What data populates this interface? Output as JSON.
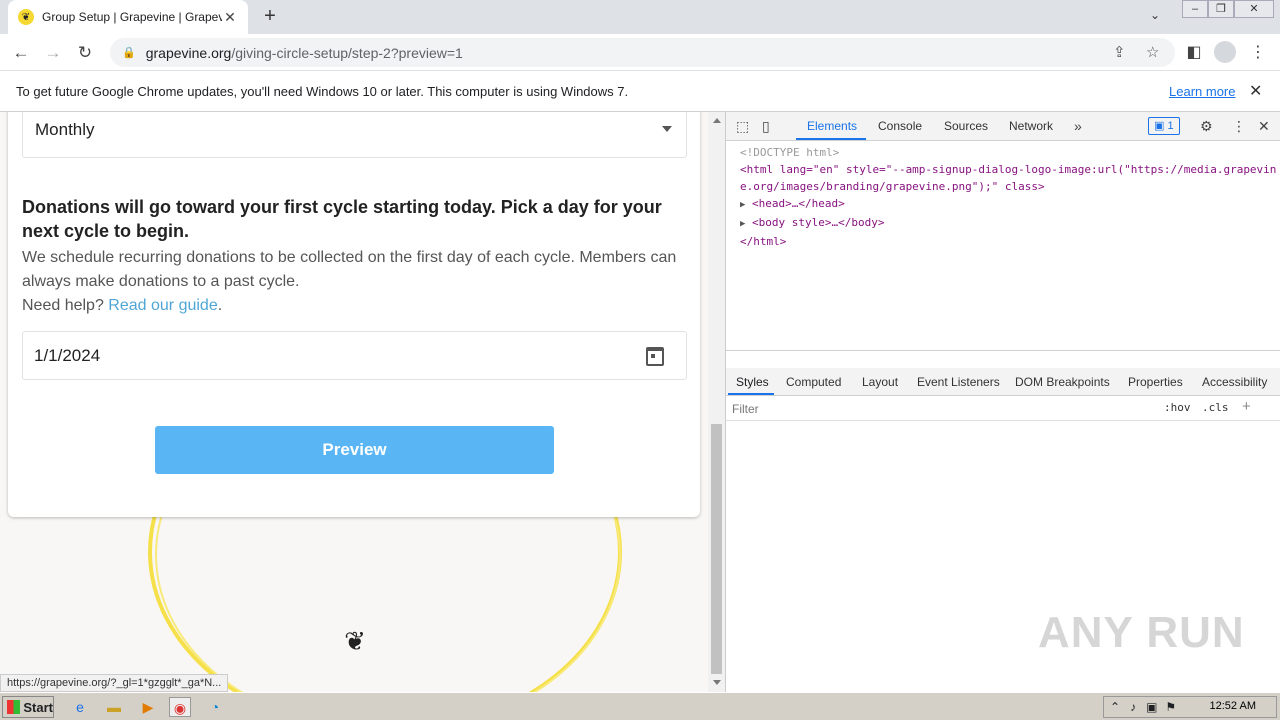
{
  "browser": {
    "tab_title": "Group Setup | Grapevine | Grapevine",
    "tab_close": "✕",
    "new_tab": "+",
    "url_host": "grapevine.org",
    "url_path": "/giving-circle-setup/step-2?preview=1"
  },
  "infobar": {
    "message": "To get future Google Chrome updates, you'll need Windows 10 or later. This computer is using Windows 7.",
    "link": "Learn more"
  },
  "form": {
    "frequency_value": "Monthly",
    "heading": "Donations will go toward your first cycle starting today. Pick a day for your next cycle to begin.",
    "description": "We schedule recurring donations to be collected on the first day of each cycle. Members can always make donations to a past cycle.",
    "help_prefix": "Need help? ",
    "help_link": "Read our guide",
    "help_suffix": ".",
    "date_value": "1/1/2024",
    "preview_button": "Preview"
  },
  "status_url": "https://grapevine.org/?_gl=1*gzgglt*_ga*N...",
  "devtools": {
    "tabs": [
      "Elements",
      "Console",
      "Sources",
      "Network"
    ],
    "issues_count": "1",
    "code": {
      "doctype": "<!DOCTYPE html>",
      "html_open": "<html lang=\"en\" style=\"--amp-signup-dialog-logo-image:url(\"https://media.grapevine.org/images/branding/grapevine.png\");\" class>",
      "head": "<head>…</head>",
      "body": "<body style>…</body>",
      "html_close": "</html>"
    },
    "styles_tabs": [
      "Styles",
      "Computed",
      "Layout",
      "Event Listeners",
      "DOM Breakpoints",
      "Properties",
      "Accessibility"
    ],
    "filter_placeholder": "Filter",
    "hov": ":hov",
    "cls": ".cls",
    "watermark": "ANY RUN"
  },
  "taskbar": {
    "start": "Start",
    "clock": "12:52 AM"
  },
  "colors": {
    "accent_button": "#5ab5f5",
    "link": "#4fa6d6",
    "devtools_active": "#1a73e8"
  }
}
